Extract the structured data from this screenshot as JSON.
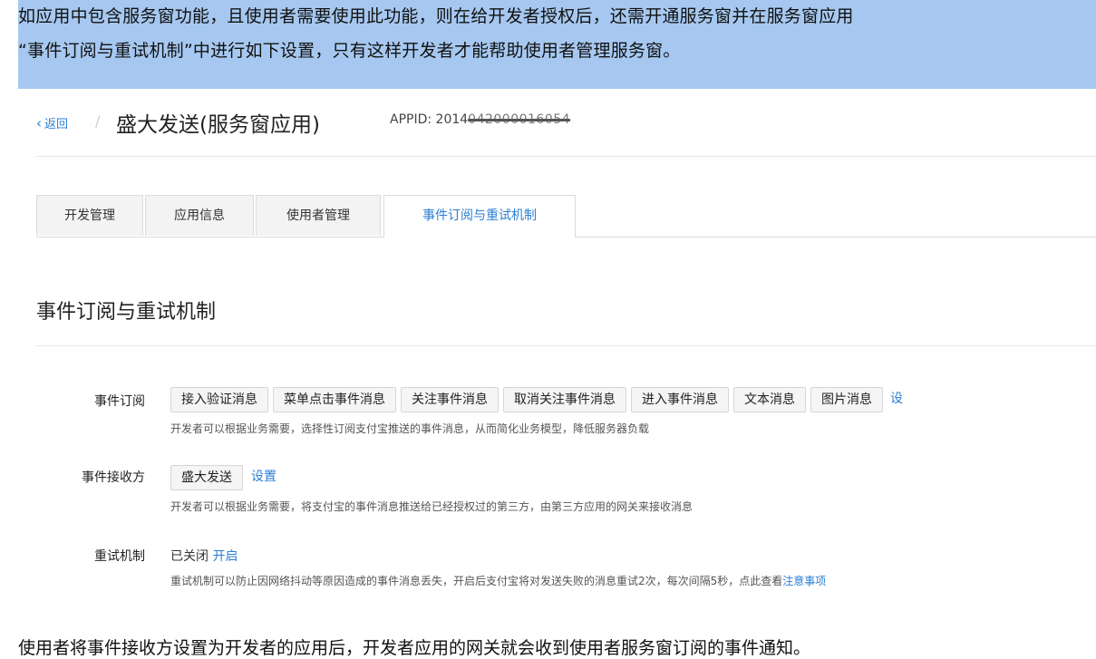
{
  "banner": {
    "line1": "如应用中包含服务窗功能，且使用者需要使用此功能，则在给开发者授权后，还需开通服务窗并在服务窗应用",
    "line2": "“事件订阅与重试机制”中进行如下设置，只有这样开发者才能帮助使用者管理服务窗。"
  },
  "header": {
    "back_label": "返回",
    "separator": "/",
    "app_title": "盛大发送(服务窗应用)",
    "appid_label": "APPID: 2014",
    "appid_masked": "042000016054"
  },
  "tabs": [
    {
      "label": "开发管理"
    },
    {
      "label": "应用信息"
    },
    {
      "label": "使用者管理"
    },
    {
      "label": "事件订阅与重试机制"
    }
  ],
  "section_title": "事件订阅与重试机制",
  "event_subscribe": {
    "label": "事件订阅",
    "chips": [
      "接入验证消息",
      "菜单点击事件消息",
      "关注事件消息",
      "取消关注事件消息",
      "进入事件消息",
      "文本消息",
      "图片消息"
    ],
    "trailing_link": "设",
    "description": "开发者可以根据业务需要，选择性订阅支付宝推送的事件消息，从而简化业务模型，降低服务器负载"
  },
  "event_receiver": {
    "label": "事件接收方",
    "chip": "盛大发送",
    "link": "设置",
    "description": "开发者可以根据业务需要，将支付宝的事件消息推送给已经授权过的第三方，由第三方应用的网关来接收消息"
  },
  "retry": {
    "label": "重试机制",
    "status": "已关闭",
    "toggle_link": "开启",
    "description": "重试机制可以防止因网络抖动等原因造成的事件消息丢失，开启后支付宝将对发送失败的消息重试2次，每次间隔5秒，点此查看",
    "notes_link": "注意事项"
  },
  "footer": "使用者将事件接收方设置为开发者的应用后，开发者应用的网关就会收到使用者服务窗订阅的事件通知。",
  "colors": {
    "banner": "#a6c8f0",
    "link": "#2b7fd4"
  }
}
